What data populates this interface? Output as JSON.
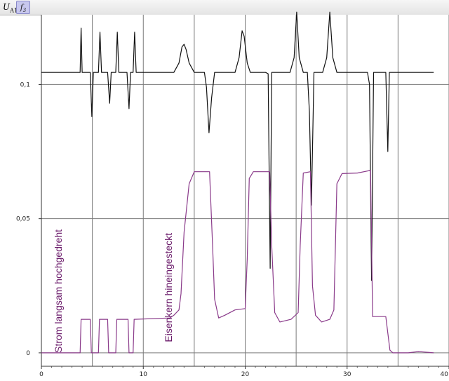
{
  "toolbar": {
    "y_symbol": "U",
    "y_sub": "A1",
    "button_symbol": "f",
    "button_sub": "3"
  },
  "chart_data": {
    "type": "line",
    "xlim": [
      0,
      40
    ],
    "ylim": [
      -0.005,
      0.126
    ],
    "x_ticks": [
      0,
      10,
      20,
      30,
      40
    ],
    "x_tick_labels": [
      "0",
      "10",
      "20",
      "30",
      "40"
    ],
    "y_ticks": [
      0,
      0.05,
      0.1
    ],
    "y_tick_labels": [
      "0",
      "0,05",
      "0,1"
    ],
    "x_gridlines": [
      0,
      5,
      10,
      15,
      20,
      25,
      30,
      35,
      40
    ],
    "y_gridlines": [
      0,
      0.05,
      0.1
    ],
    "grid": true,
    "colors": {
      "black_series": "#111111",
      "purple_series": "#8a3a8a",
      "annotation": "#6a1a6a",
      "grid": "#7a7a7a"
    },
    "annotations": [
      {
        "text": "Strom langsam hochgedreht",
        "x": 2.0,
        "y": 0.0,
        "rotation": -90
      },
      {
        "text": "Eisenkern hineingesteckt",
        "x": 12.8,
        "y": 0.004,
        "rotation": -90
      }
    ],
    "series": [
      {
        "color": "#111111",
        "points": [
          [
            0,
            0.1045
          ],
          [
            3.8,
            0.1045
          ],
          [
            3.9,
            0.121
          ],
          [
            4.0,
            0.1045
          ],
          [
            4.8,
            0.1045
          ],
          [
            4.95,
            0.088
          ],
          [
            5.1,
            0.1045
          ],
          [
            5.6,
            0.1045
          ],
          [
            5.75,
            0.1195
          ],
          [
            5.9,
            0.1045
          ],
          [
            6.5,
            0.1045
          ],
          [
            6.7,
            0.093
          ],
          [
            6.85,
            0.1045
          ],
          [
            7.3,
            0.1045
          ],
          [
            7.45,
            0.1195
          ],
          [
            7.6,
            0.1045
          ],
          [
            8.4,
            0.1045
          ],
          [
            8.6,
            0.091
          ],
          [
            8.75,
            0.1045
          ],
          [
            9.0,
            0.1045
          ],
          [
            9.15,
            0.1195
          ],
          [
            9.3,
            0.1045
          ],
          [
            13.0,
            0.1045
          ],
          [
            13.5,
            0.108
          ],
          [
            13.8,
            0.114
          ],
          [
            14.0,
            0.115
          ],
          [
            14.2,
            0.113
          ],
          [
            14.5,
            0.108
          ],
          [
            15.0,
            0.1045
          ],
          [
            16.0,
            0.1045
          ],
          [
            16.2,
            0.099
          ],
          [
            16.45,
            0.082
          ],
          [
            16.7,
            0.095
          ],
          [
            17.0,
            0.1045
          ],
          [
            19.0,
            0.1045
          ],
          [
            19.4,
            0.11
          ],
          [
            19.7,
            0.12
          ],
          [
            19.9,
            0.118
          ],
          [
            20.2,
            0.108
          ],
          [
            20.5,
            0.1045
          ],
          [
            22.0,
            0.1045
          ],
          [
            22.25,
            0.104
          ],
          [
            22.45,
            0.0315
          ],
          [
            22.6,
            0.1045
          ],
          [
            24.4,
            0.1045
          ],
          [
            24.8,
            0.11
          ],
          [
            25.05,
            0.127
          ],
          [
            25.3,
            0.11
          ],
          [
            25.7,
            0.1045
          ],
          [
            26.1,
            0.1045
          ],
          [
            26.3,
            0.09
          ],
          [
            26.5,
            0.055
          ],
          [
            26.75,
            0.1045
          ],
          [
            27.6,
            0.1045
          ],
          [
            28.0,
            0.11
          ],
          [
            28.3,
            0.127
          ],
          [
            28.6,
            0.11
          ],
          [
            29.0,
            0.1045
          ],
          [
            32.0,
            0.1045
          ],
          [
            32.2,
            0.1
          ],
          [
            32.4,
            0.027
          ],
          [
            32.6,
            0.1045
          ],
          [
            33.8,
            0.1045
          ],
          [
            34.0,
            0.075
          ],
          [
            34.15,
            0.1045
          ],
          [
            38.5,
            0.1045
          ]
        ]
      },
      {
        "color": "#8a3a8a",
        "points": [
          [
            0,
            0
          ],
          [
            3.8,
            0
          ],
          [
            3.9,
            0.0125
          ],
          [
            4.8,
            0.0125
          ],
          [
            4.9,
            0
          ],
          [
            5.6,
            0
          ],
          [
            5.7,
            0.0125
          ],
          [
            6.5,
            0.0125
          ],
          [
            6.6,
            0
          ],
          [
            7.3,
            0
          ],
          [
            7.4,
            0.0125
          ],
          [
            8.5,
            0.0125
          ],
          [
            8.6,
            0
          ],
          [
            9.0,
            0
          ],
          [
            9.1,
            0.0125
          ],
          [
            12.6,
            0.013
          ],
          [
            13.0,
            0.014
          ],
          [
            13.5,
            0.016
          ],
          [
            13.7,
            0.022
          ],
          [
            14.0,
            0.045
          ],
          [
            14.5,
            0.063
          ],
          [
            15.0,
            0.0675
          ],
          [
            16.5,
            0.0675
          ],
          [
            16.8,
            0.04
          ],
          [
            17.0,
            0.02
          ],
          [
            17.4,
            0.013
          ],
          [
            18.0,
            0.014
          ],
          [
            19.0,
            0.016
          ],
          [
            20.0,
            0.0165
          ],
          [
            20.2,
            0.035
          ],
          [
            20.4,
            0.065
          ],
          [
            20.8,
            0.0675
          ],
          [
            22.4,
            0.0675
          ],
          [
            22.6,
            0.04
          ],
          [
            22.9,
            0.015
          ],
          [
            23.4,
            0.0115
          ],
          [
            24.5,
            0.0125
          ],
          [
            25.2,
            0.015
          ],
          [
            25.4,
            0.04
          ],
          [
            25.7,
            0.067
          ],
          [
            26.4,
            0.0675
          ],
          [
            26.6,
            0.025
          ],
          [
            26.9,
            0.014
          ],
          [
            27.5,
            0.0115
          ],
          [
            28.3,
            0.0125
          ],
          [
            28.7,
            0.016
          ],
          [
            29.0,
            0.063
          ],
          [
            29.5,
            0.0668
          ],
          [
            31.0,
            0.067
          ],
          [
            32.3,
            0.068
          ],
          [
            32.5,
            0.0135
          ],
          [
            33.8,
            0.0135
          ],
          [
            34.2,
            0.001
          ],
          [
            34.5,
            0
          ],
          [
            36.0,
            0
          ],
          [
            37.0,
            0.0005
          ],
          [
            38.5,
            0
          ]
        ]
      }
    ]
  }
}
